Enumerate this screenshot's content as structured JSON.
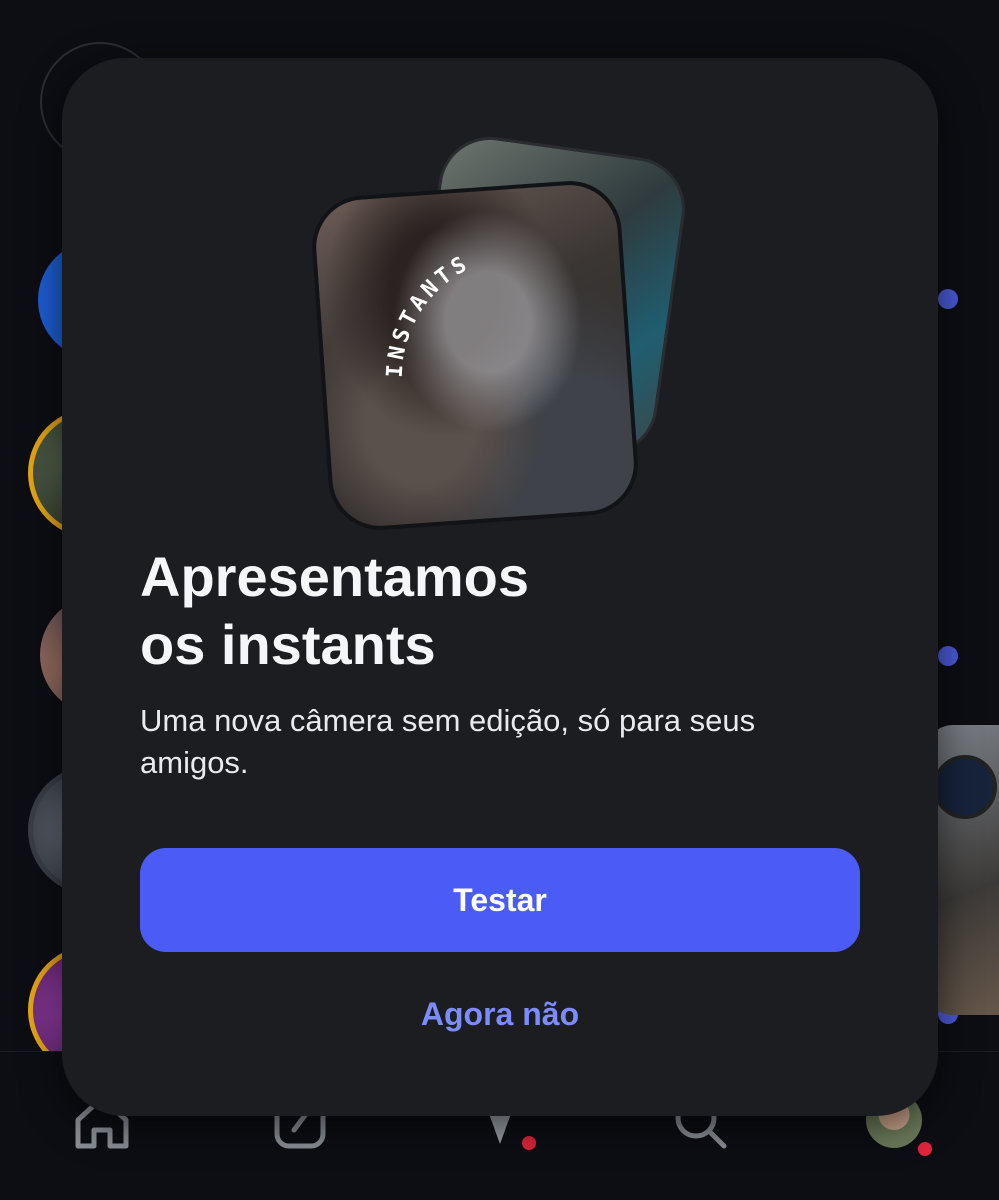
{
  "app": {
    "accent_color": "#4a5cf5",
    "link_color": "#7c8cff",
    "background_color": "#0c0e13",
    "modal_color": "#1b1d21"
  },
  "modal": {
    "hero": {
      "curved_label": "INSTANTS",
      "image_description_icon": "photo-stack-icon"
    },
    "title": "Apresentamos\nos instants",
    "subtitle": "Uma nova câmera sem edição, só para seus amigos.",
    "primary_button": "Testar",
    "secondary_button": "Agora não"
  },
  "bottom_nav": {
    "items": [
      {
        "name": "home",
        "icon": "home-icon"
      },
      {
        "name": "compose",
        "icon": "compose-icon"
      },
      {
        "name": "instants",
        "icon": "instants-icon",
        "has_notification": true
      },
      {
        "name": "search",
        "icon": "search-icon"
      },
      {
        "name": "profile",
        "icon": "profile-avatar",
        "has_notification": true
      }
    ]
  }
}
